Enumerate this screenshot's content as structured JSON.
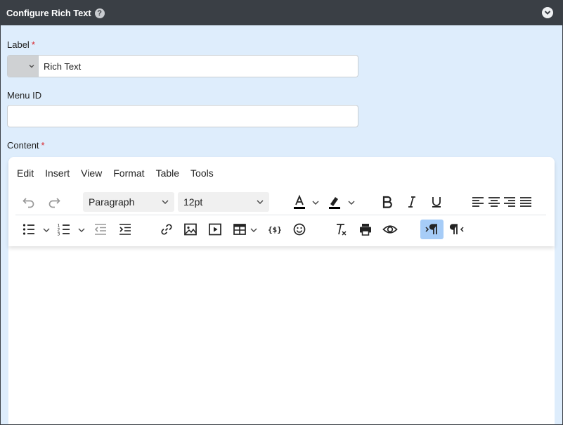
{
  "panel": {
    "title": "Configure Rich Text",
    "help": "?"
  },
  "fields": {
    "label": {
      "text": "Label",
      "required": "*",
      "value": "Rich Text"
    },
    "menu_id": {
      "text": "Menu ID",
      "value": ""
    },
    "content": {
      "text": "Content",
      "required": "*"
    }
  },
  "editor": {
    "menu": [
      "Edit",
      "Insert",
      "View",
      "Format",
      "Table",
      "Tools"
    ],
    "block_format": "Paragraph",
    "font_size": "12pt",
    "accent_active": "#a6ccf7"
  }
}
